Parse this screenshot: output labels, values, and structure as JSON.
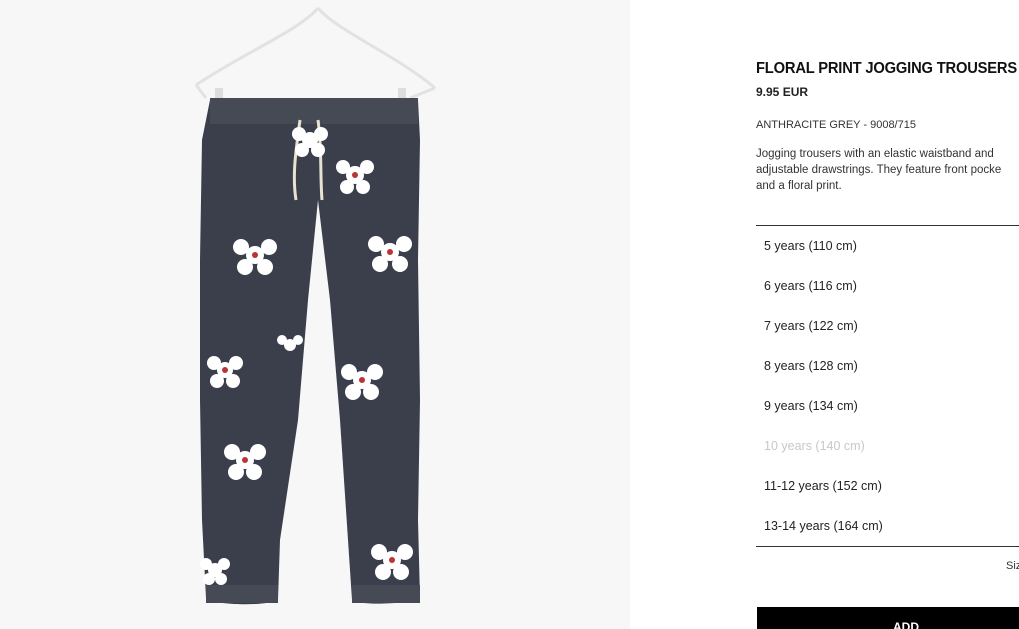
{
  "product": {
    "title": "FLORAL PRINT JOGGING TROUSERS",
    "price": "9.95 EUR",
    "color_ref": "ANTHRACITE GREY - 9008/715",
    "description_lines": [
      "Jogging trousers with an elastic waistband and",
      "adjustable drawstrings. They feature front pocke",
      "and a floral print."
    ]
  },
  "sizes": [
    {
      "label": "5 years (110 cm)",
      "available": true
    },
    {
      "label": "6 years (116 cm)",
      "available": true
    },
    {
      "label": "7 years (122 cm)",
      "available": true
    },
    {
      "label": "8 years (128 cm)",
      "available": true
    },
    {
      "label": "9 years (134 cm)",
      "available": true
    },
    {
      "label": "10 years (140 cm)",
      "available": false
    },
    {
      "label": "11-12 years (152 cm)",
      "available": true
    },
    {
      "label": "13-14 years (164 cm)",
      "available": true
    }
  ],
  "size_guide_label": "Siz",
  "add_button_label": "ADD",
  "colors": {
    "trousers": "#3a3f4b",
    "flower": "#ffffff",
    "button": "#000000"
  }
}
